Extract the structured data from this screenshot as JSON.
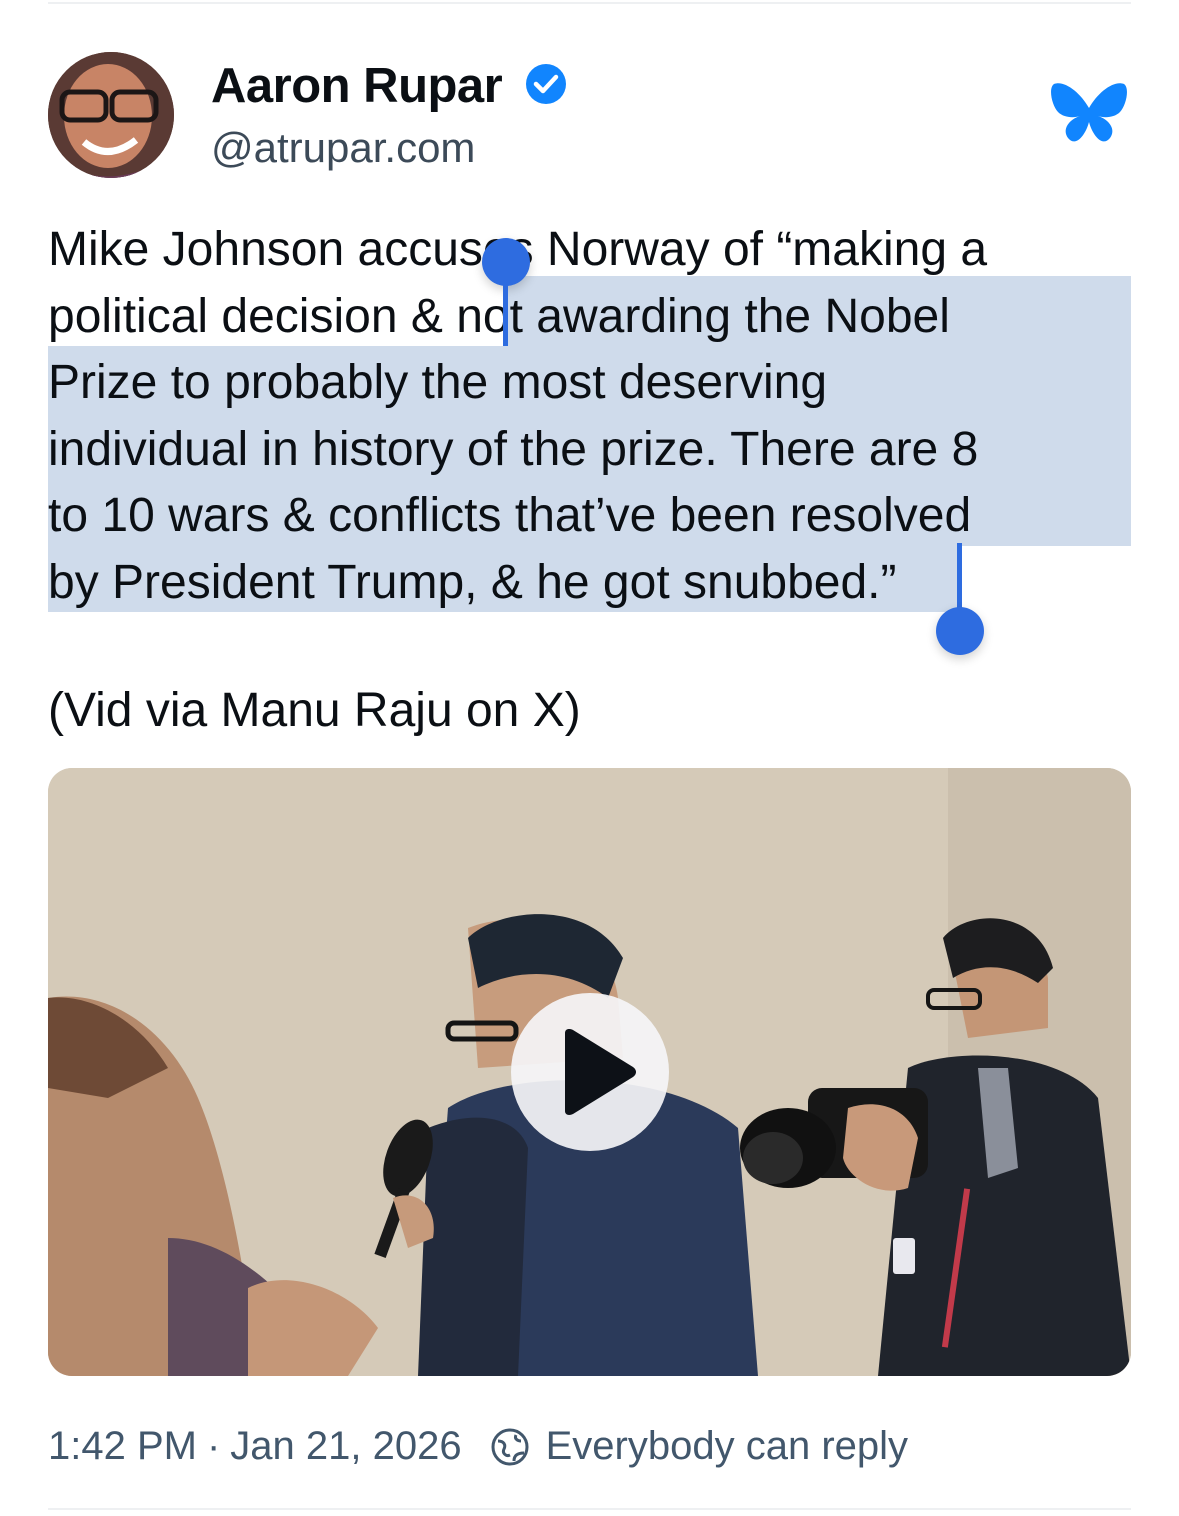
{
  "author": {
    "name": "Aaron Rupar",
    "handle": "@atrupar.com",
    "verified": true
  },
  "post": {
    "line1": "Mike Johnson accuses Norway of “making a",
    "line2": "political decision & not awarding the Nobel",
    "line3": "Prize to probably the most deserving",
    "line4": "individual in history of the prize. There are 8",
    "line5": "to 10 wars & conflicts that’ve been resolved",
    "line6": "by President Trump, & he got snubbed.”",
    "credit": "(Vid via Manu Raju on X)"
  },
  "video": {
    "play_icon": "play-icon"
  },
  "footer": {
    "time": "1:42 PM",
    "separator": "·",
    "date": "Jan 21, 2026",
    "reply_setting": "Everybody can reply"
  },
  "colors": {
    "accent": "#2e6ce0",
    "selection": "#cfdbeb",
    "muted_text": "#42576c",
    "bluesky": "#1185fe"
  }
}
